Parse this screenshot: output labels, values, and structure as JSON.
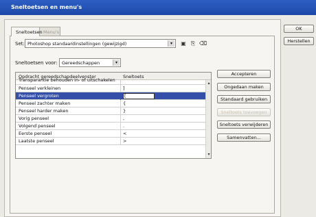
{
  "window": {
    "title": "Sneltoetsen en menu's"
  },
  "tabs": [
    {
      "label": "Sneltoetsen"
    },
    {
      "label": "Menu's"
    }
  ],
  "set": {
    "label": "Set:",
    "value": "Photoshop standaardinstellingen (gewijzigd)"
  },
  "shortcuts_for": {
    "label": "Sneltoetsen voor:",
    "value": "Gereedschappen"
  },
  "table": {
    "headers": [
      "Opdracht gereedschapdeelvenster",
      "Sneltoets"
    ],
    "rows": [
      {
        "command": "Transparantie behouden in- of uitschakelen",
        "shortcut": ""
      },
      {
        "command": "Penseel verkleinen",
        "shortcut": "]"
      },
      {
        "command": "Penseel vergroten",
        "shortcut": "[",
        "selected": true
      },
      {
        "command": "Penseel zachter maken",
        "shortcut": "{"
      },
      {
        "command": "Penseel harder maken",
        "shortcut": "}"
      },
      {
        "command": "Vorig penseel",
        "shortcut": ","
      },
      {
        "command": "Volgend penseel",
        "shortcut": "."
      },
      {
        "command": "Eerste penseel",
        "shortcut": "<"
      },
      {
        "command": "Laatste penseel",
        "shortcut": ">"
      }
    ]
  },
  "side_buttons": {
    "accept": "Accepteren",
    "undo": "Ongedaan maken",
    "use_default": "Standaard gebruiken",
    "add_shortcut": "Sneltoets toevoegen",
    "remove_shortcut": "Sneltoets verwijderen",
    "summarize": "Samenvatten..."
  },
  "dialog_buttons": {
    "ok": "OK",
    "reset": "Herstellen"
  },
  "colors": {
    "selection": "#344fa8",
    "titlebar": "#1c47a8"
  }
}
